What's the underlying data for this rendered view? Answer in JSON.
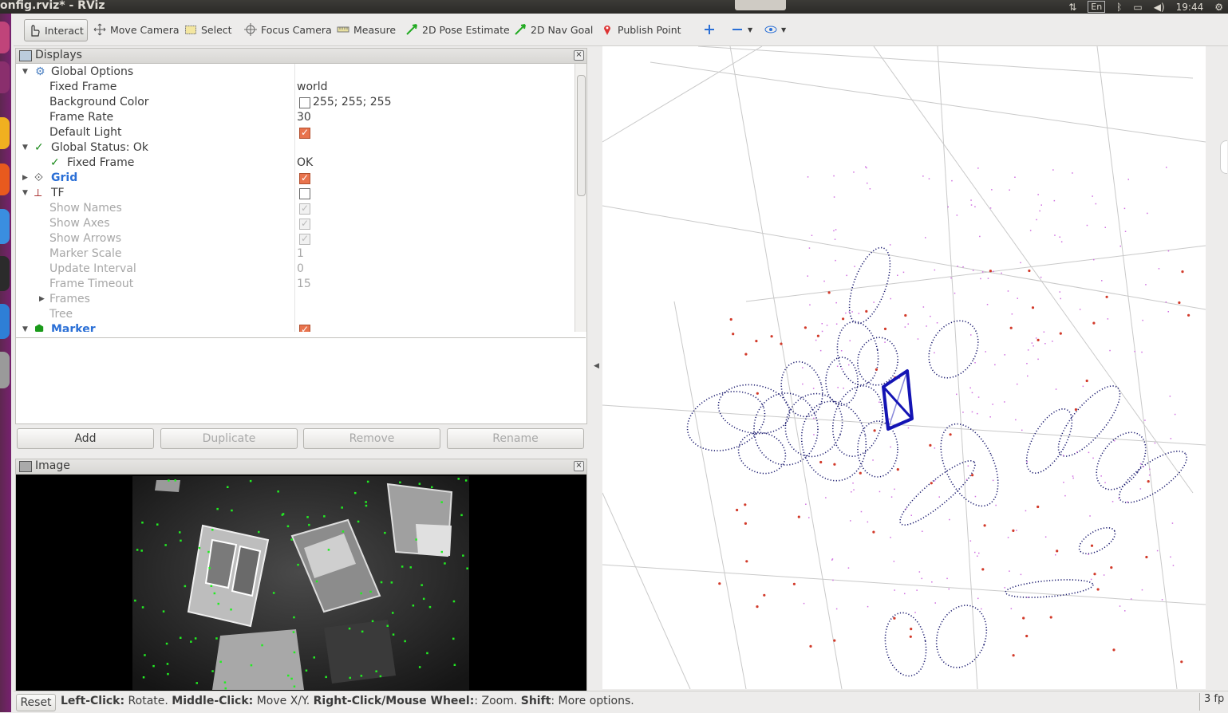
{
  "window": {
    "title": "onfig.rviz* - RViz"
  },
  "tray": {
    "keyboard": "En",
    "clock": "19:44"
  },
  "toolbar": {
    "interact": "Interact",
    "move_camera": "Move Camera",
    "select": "Select",
    "focus_camera": "Focus Camera",
    "measure": "Measure",
    "pose_estimate": "2D Pose Estimate",
    "nav_goal": "2D Nav Goal",
    "publish_point": "Publish Point"
  },
  "displays": {
    "title": "Displays",
    "rows": [
      {
        "label": "Global Options",
        "value": ""
      },
      {
        "label": "Fixed Frame",
        "value": "world"
      },
      {
        "label": "Background Color",
        "value": "255; 255; 255"
      },
      {
        "label": "Frame Rate",
        "value": "30"
      },
      {
        "label": "Default Light",
        "value": ""
      },
      {
        "label": "Global Status: Ok",
        "value": ""
      },
      {
        "label": "Fixed Frame",
        "value": "OK"
      },
      {
        "label": "Grid",
        "value": ""
      },
      {
        "label": "TF",
        "value": ""
      },
      {
        "label": "Show Names",
        "value": ""
      },
      {
        "label": "Show Axes",
        "value": ""
      },
      {
        "label": "Show Arrows",
        "value": ""
      },
      {
        "label": "Marker Scale",
        "value": "1"
      },
      {
        "label": "Update Interval",
        "value": "0"
      },
      {
        "label": "Frame Timeout",
        "value": "15"
      },
      {
        "label": "Frames",
        "value": ""
      },
      {
        "label": "Tree",
        "value": ""
      },
      {
        "label": "Marker",
        "value": ""
      }
    ]
  },
  "buttons": {
    "add": "Add",
    "duplicate": "Duplicate",
    "remove": "Remove",
    "rename": "Rename"
  },
  "image_panel": {
    "title": "Image"
  },
  "status": {
    "reset": "Reset",
    "hint_parts": [
      {
        "b": "Left-Click:",
        "t": " Rotate. "
      },
      {
        "b": "Middle-Click:",
        "t": " Move X/Y. "
      },
      {
        "b": "Right-Click/Mouse Wheel:",
        "t": ": Zoom. "
      },
      {
        "b": "Shift",
        "t": ": More options."
      }
    ],
    "fps": "3 fp"
  },
  "colors": {
    "accent": "#2a6fd6",
    "checkbox": "#e8734d",
    "trajectory": "#1a1a6e",
    "camera": "#1414b4",
    "launcher": "#77216f"
  }
}
